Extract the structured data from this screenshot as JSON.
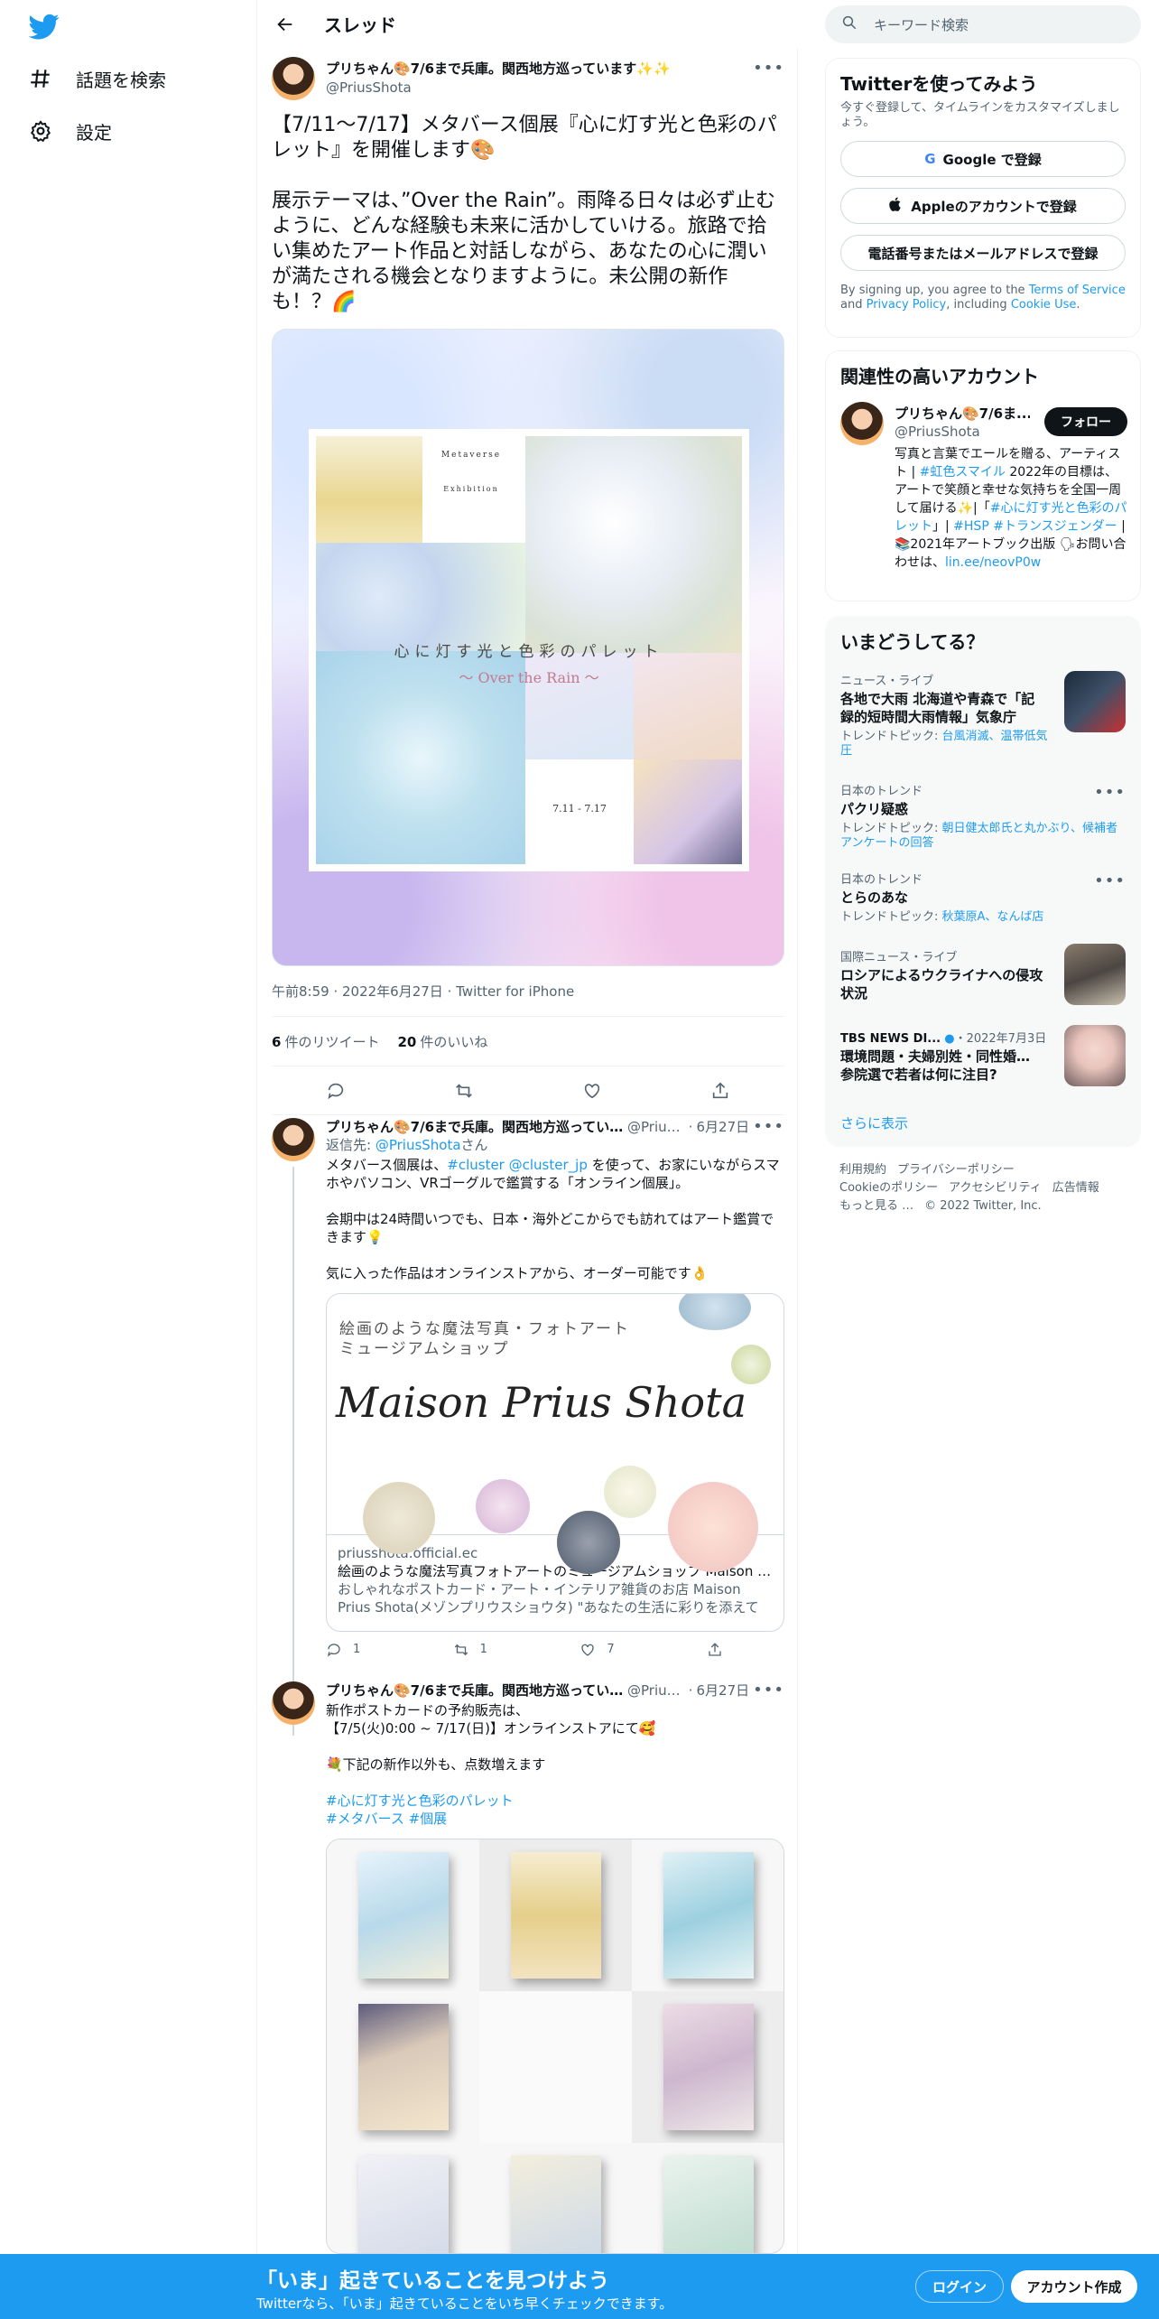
{
  "nav": {
    "explore_label": "話題を検索",
    "settings_label": "設定"
  },
  "thread": {
    "title": "スレッド"
  },
  "main_tweet": {
    "name": "プリちゃん🎨7/6まで兵庫。関西地方巡っています✨✨",
    "handle": "@PriusShota",
    "text": "【7/11〜7/17】メタバース個展『心に灯す光と色彩のパレット』を開催します🎨\n\n展示テーマは、”Over the Rain”。雨降る日々は必ず止むように、どんな経験も未来に活かしていける。旅路で拾い集めたアート作品と対話しながら、あなたの心に潤いが満たされる機会となりますように。未公開の新作も！？🌈",
    "poster_meta1": "Metaverse",
    "poster_meta2": "Exhibition",
    "poster_title": "心に灯す光と色彩のパレット",
    "poster_subtitle": "～ Over the Rain ～",
    "poster_dates": "7.11 - 7.17",
    "time": "午前8:59",
    "date": "2022年6月27日",
    "client": "Twitter for iPhone",
    "retweets_count": "6",
    "retweets_label": "件のリツイート",
    "likes_count": "20",
    "likes_label": "件のいいね"
  },
  "reply1": {
    "name": "プリちゃん🎨7/6まで兵庫。関西地方巡っています✨",
    "handle": "@Prius...",
    "date": "6月27日",
    "reply_to_prefix": "返信先: ",
    "reply_to_handle": "@PriusShota",
    "reply_to_suffix": "さん",
    "text_pre": "メタバース個展は、",
    "link1": "#cluster",
    "link2": "@cluster_jp",
    "text_post": " を使って、お家にいながらスマホやパソコン、VRゴーグルで鑑賞する「オンライン個展」。\n\n会期中は24時間いつでも、日本・海外どこからでも訪れてはアート鑑賞できます💡\n\n気に入った作品はオンラインストアから、オーダー可能です👌",
    "card_heading": "絵画のような魔法写真・フォトアート\nミュージアムショップ",
    "card_script": "Maison Prius Shota",
    "card_domain": "priusshota.official.ec",
    "card_title": "絵画のような魔法写真フォトアートのミュージアムショップ Maison Prius Shota",
    "card_desc": "おしゃれなポストカード・アート・インテリア雑貨のお店 Maison Prius Shota(メゾンプリウスショウタ) \"あなたの生活に彩りを添えて",
    "replies": "1",
    "retweets": "1",
    "likes": "7"
  },
  "reply2": {
    "name": "プリちゃん🎨7/6まで兵庫。関西地方巡っています",
    "handle": "@Prius...",
    "date": "6月27日",
    "text": "新作ポストカードの予約販売は、\n【7/5(火)0:00 ~ 7/17(日)】オンラインストアにて🥰\n\n💐下記の新作以外も、点数増えます",
    "tag1": "#心に灯す光と色彩のパレット",
    "tag2": "#メタバース",
    "tag3": "#個展"
  },
  "right": {
    "search_placeholder": "キーワード検索",
    "signup_title": "Twitterを使ってみよう",
    "signup_sub": "今すぐ登録して、タイムラインをカスタマイズしましょう。",
    "google_btn": "Google で登録",
    "apple_btn": "Appleのアカウントで登録",
    "phone_btn": "電話番号またはメールアドレスで登録",
    "terms_pre": "By signing up, you agree to the ",
    "terms_link": "Terms of Service",
    "terms_mid": " and ",
    "privacy_link": "Privacy Policy",
    "terms_mid2": ", including ",
    "cookie_link": "Cookie Use",
    "terms_end": ".",
    "related_title": "関連性の高いアカウント",
    "related_name": "プリちゃん🎨7/6ま...",
    "related_handle": "@PriusShota",
    "follow_btn": "フォロー",
    "bio_1": "写真と言葉でエールを贈る、アーティスト | ",
    "bio_tag1": "#虹色スマイル",
    "bio_2": " 2022年の目標は、アートで笑顔と幸せな気持ちを全国一周して届ける✨|「",
    "bio_tag2": "#心に灯す光と色彩のパレット",
    "bio_3": "」| ",
    "bio_tag3": "#HSP",
    "bio_4": " ",
    "bio_tag4": "#トランスジェンダー",
    "bio_5": " | 📚2021年アートブック出版 🗣お問い合わせは、",
    "bio_link": "lin.ee/neovP0w",
    "trends_title": "いまどうしてる？",
    "trends": [
      {
        "ctx": "ニュース・ライブ",
        "title": "各地で大雨 北海道や青森で「記録的短時間大雨情報」気象庁",
        "sub_pre": "トレンドトピック: ",
        "sub_link": "台風消滅、温帯低気圧"
      },
      {
        "ctx": "日本のトレンド",
        "title": "パクリ疑惑",
        "sub_pre": "トレンドトピック: ",
        "sub_link": "朝日健太郎氏と丸かぶり、候補者アンケートの回答"
      },
      {
        "ctx": "日本のトレンド",
        "title": "とらのあな",
        "sub_pre": "トレンドトピック: ",
        "sub_link": "秋葉原A、なんば店"
      },
      {
        "ctx": "国際ニュース・ライブ",
        "title": "ロシアによるウクライナへの侵攻状況",
        "sub_pre": "",
        "sub_link": ""
      },
      {
        "ctx": "TBS NEWS DI...",
        "ctx_date": "・2022年7月3日",
        "title": "環境問題・夫婦別姓・同性婚… 参院選で若者は何に注目?",
        "sub_pre": "",
        "sub_link": ""
      }
    ],
    "show_more": "さらに表示",
    "footer": [
      "利用規約",
      "プライバシーポリシー",
      "Cookieのポリシー",
      "アクセシビリティ",
      "広告情報",
      "もっと見る …",
      "© 2022 Twitter, Inc."
    ]
  },
  "banner": {
    "headline": "「いま」起きていることを見つけよう",
    "sub": "Twitterなら、「いま」起きていることをいち早くチェックできます。",
    "login": "ログイン",
    "signup": "アカウント作成"
  },
  "colors": {
    "accent": "#1d9bf0",
    "text": "#0f1419",
    "muted": "#536471"
  }
}
